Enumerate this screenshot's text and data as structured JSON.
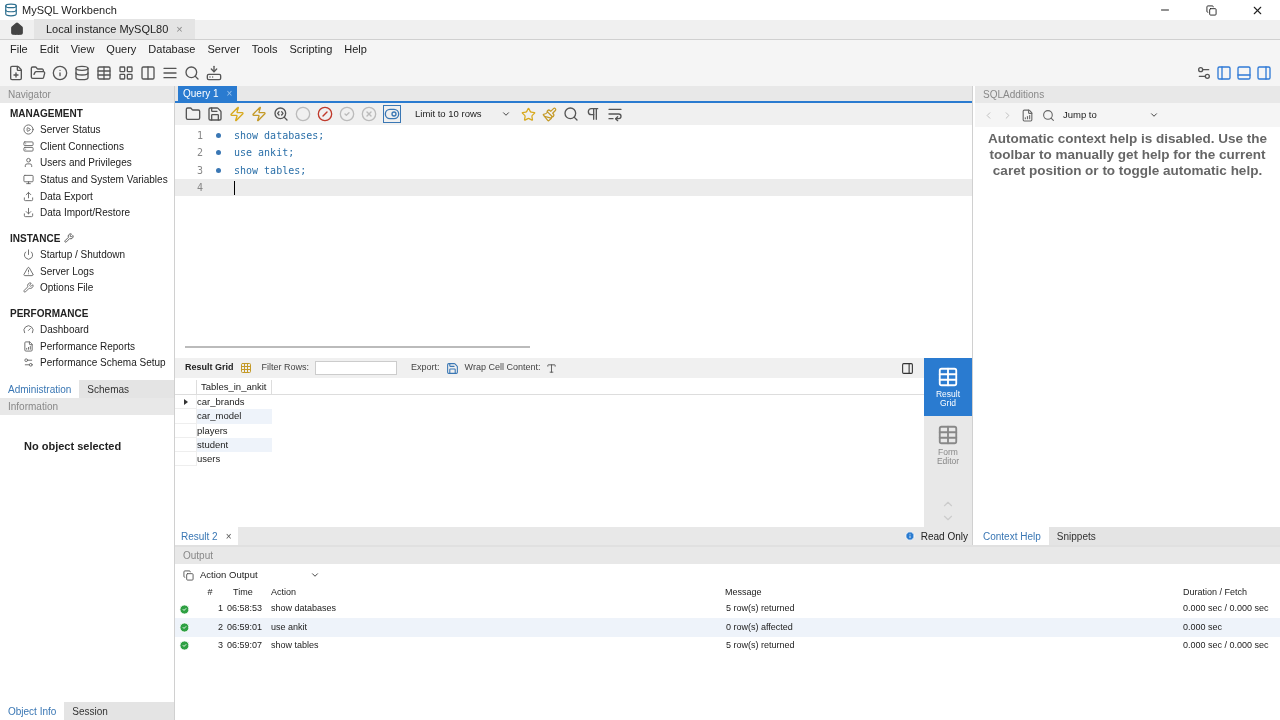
{
  "window": {
    "title": "MySQL Workbench"
  },
  "connection_tabs": [
    {
      "label": "Local instance MySQL80",
      "close": "×",
      "selected": true
    }
  ],
  "menu": [
    "File",
    "Edit",
    "View",
    "Query",
    "Database",
    "Server",
    "Tools",
    "Scripting",
    "Help"
  ],
  "navigator": {
    "title": "Navigator",
    "sections": [
      {
        "title": "MANAGEMENT",
        "items": [
          {
            "label": "Server Status"
          },
          {
            "label": "Client Connections"
          },
          {
            "label": "Users and Privileges"
          },
          {
            "label": "Status and System Variables"
          },
          {
            "label": "Data Export"
          },
          {
            "label": "Data Import/Restore"
          }
        ]
      },
      {
        "title": "INSTANCE",
        "items": [
          {
            "label": "Startup / Shutdown"
          },
          {
            "label": "Server Logs"
          },
          {
            "label": "Options File"
          }
        ]
      },
      {
        "title": "PERFORMANCE",
        "items": [
          {
            "label": "Dashboard"
          },
          {
            "label": "Performance Reports"
          },
          {
            "label": "Performance Schema Setup"
          }
        ]
      }
    ],
    "tabs": [
      {
        "label": "Administration",
        "selected": true
      },
      {
        "label": "Schemas",
        "selected": false
      }
    ]
  },
  "information": {
    "title": "Information",
    "message": "No object selected",
    "tabs": [
      {
        "label": "Object Info",
        "selected": true
      },
      {
        "label": "Session",
        "selected": false
      }
    ]
  },
  "query_tabs": [
    {
      "label": "Query 1",
      "close": "×",
      "selected": true
    }
  ],
  "limit": "Limit to 10 rows",
  "editor": {
    "lines": [
      {
        "number": "1",
        "marker": true,
        "code": "show databases;",
        "current": false
      },
      {
        "number": "2",
        "marker": true,
        "code": "use ankit;",
        "current": false
      },
      {
        "number": "3",
        "marker": true,
        "code": "show tables;",
        "current": false
      },
      {
        "number": "4",
        "marker": false,
        "current": true
      }
    ]
  },
  "result_toolbar": {
    "tab": "Result Grid",
    "filter_label": "Filter Rows:",
    "export_label": "Export:",
    "wrap_label": "Wrap Cell Content:"
  },
  "result_grid": {
    "columns": [
      "Tables_in_ankit"
    ],
    "rows": [
      {
        "cells": [
          "car_brands"
        ],
        "selected": true
      },
      {
        "cells": [
          "car_model"
        ],
        "selected": false
      },
      {
        "cells": [
          "players"
        ],
        "selected": false
      },
      {
        "cells": [
          "student"
        ],
        "selected": false
      },
      {
        "cells": [
          "users"
        ],
        "selected": false
      }
    ]
  },
  "result_views": [
    {
      "label": "Result Grid",
      "selected": true
    },
    {
      "label": "Form Editor",
      "selected": false
    }
  ],
  "result_tabs": [
    {
      "label": "Result 2",
      "close": "×",
      "selected": true
    }
  ],
  "read_only": "Read Only",
  "sql_additions": {
    "title": "SQLAdditions",
    "jump_to": "Jump to",
    "help_text": "Automatic context help is disabled. Use the toolbar to manually get help for the current caret position or to toggle automatic help.",
    "tabs": [
      {
        "label": "Context Help",
        "selected": true
      },
      {
        "label": "Snippets",
        "selected": false
      }
    ]
  },
  "output": {
    "title": "Output",
    "selector": "Action Output",
    "columns": [
      "#",
      "Time",
      "Action",
      "Message",
      "Duration / Fetch"
    ],
    "rows": [
      {
        "number": "1",
        "time": "06:58:53",
        "action": "show databases",
        "message": "5 row(s) returned",
        "duration": "0.000 sec / 0.000 sec",
        "selected": false
      },
      {
        "number": "2",
        "time": "06:59:01",
        "action": "use ankit",
        "message": "0 row(s) affected",
        "duration": "0.000 sec",
        "selected": true
      },
      {
        "number": "3",
        "time": "06:59:07",
        "action": "show tables",
        "message": "5 row(s) returned",
        "duration": "0.000 sec / 0.000 sec",
        "selected": false
      }
    ]
  }
}
